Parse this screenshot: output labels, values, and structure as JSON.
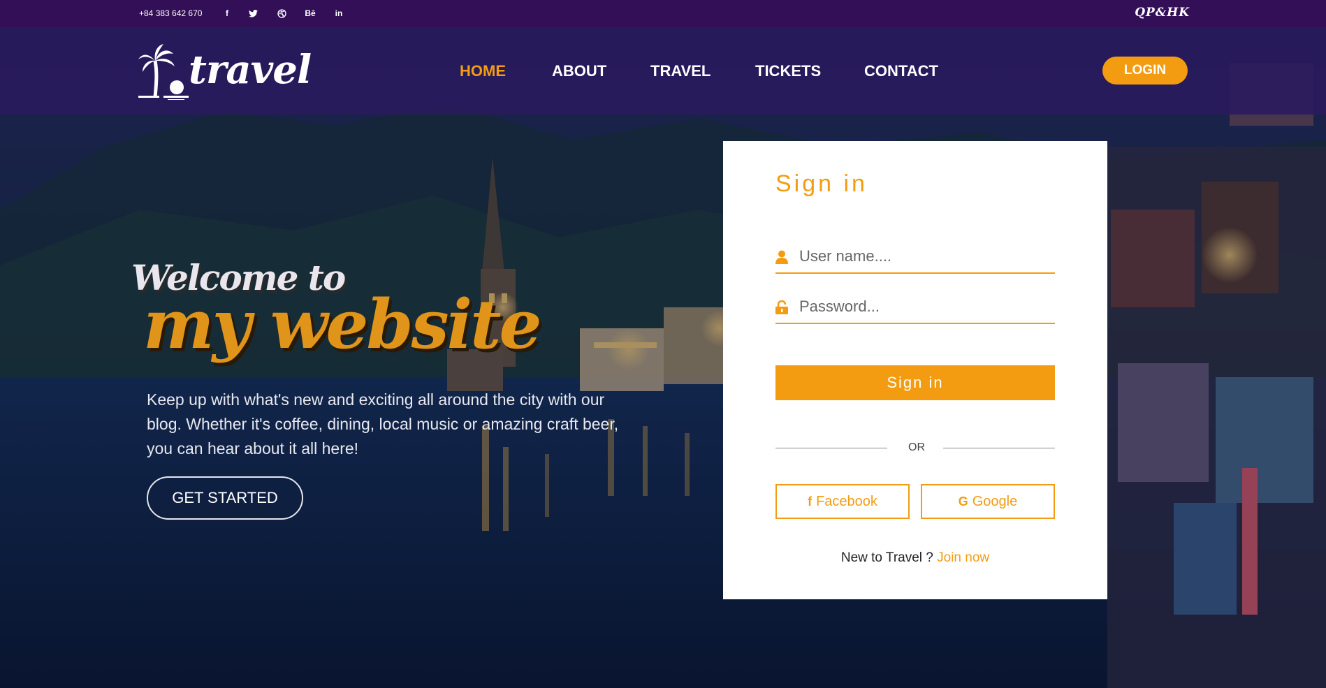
{
  "topbar": {
    "phone": "+84 383 642 670",
    "social_icons": [
      {
        "name": "facebook-icon",
        "glyph": "f"
      },
      {
        "name": "twitter-icon",
        "glyph": "🐦"
      },
      {
        "name": "dribbble-icon",
        "glyph": "◎"
      },
      {
        "name": "behance-icon",
        "glyph": "Bē"
      },
      {
        "name": "linkedin-icon",
        "glyph": "in"
      }
    ],
    "brand_mark": "QP&HK"
  },
  "nav": {
    "logo_text": "travel",
    "links": [
      "HOME",
      "ABOUT",
      "TRAVEL",
      "TICKETS",
      "CONTACT"
    ],
    "active": "HOME",
    "login_label": "LOGIN"
  },
  "hero": {
    "welcome": "Welcome to",
    "headline": "my website",
    "description": "Keep up with what's new and exciting all around the city with our blog. Whether it's coffee, dining, local music or amazing craft beer, you can hear about it all here!",
    "cta": "GET STARTED"
  },
  "signin": {
    "title": "Sign in",
    "username_placeholder": "User name....",
    "password_placeholder": "Password...",
    "submit_label": "Sign in",
    "divider": "OR",
    "facebook_label": "Facebook",
    "google_label": "Google",
    "join_prompt": "New to Travel ?",
    "join_link": "Join now"
  },
  "colors": {
    "accent": "#f39c12",
    "topbar": "#330f57",
    "navbar": "#2a1a5e"
  }
}
